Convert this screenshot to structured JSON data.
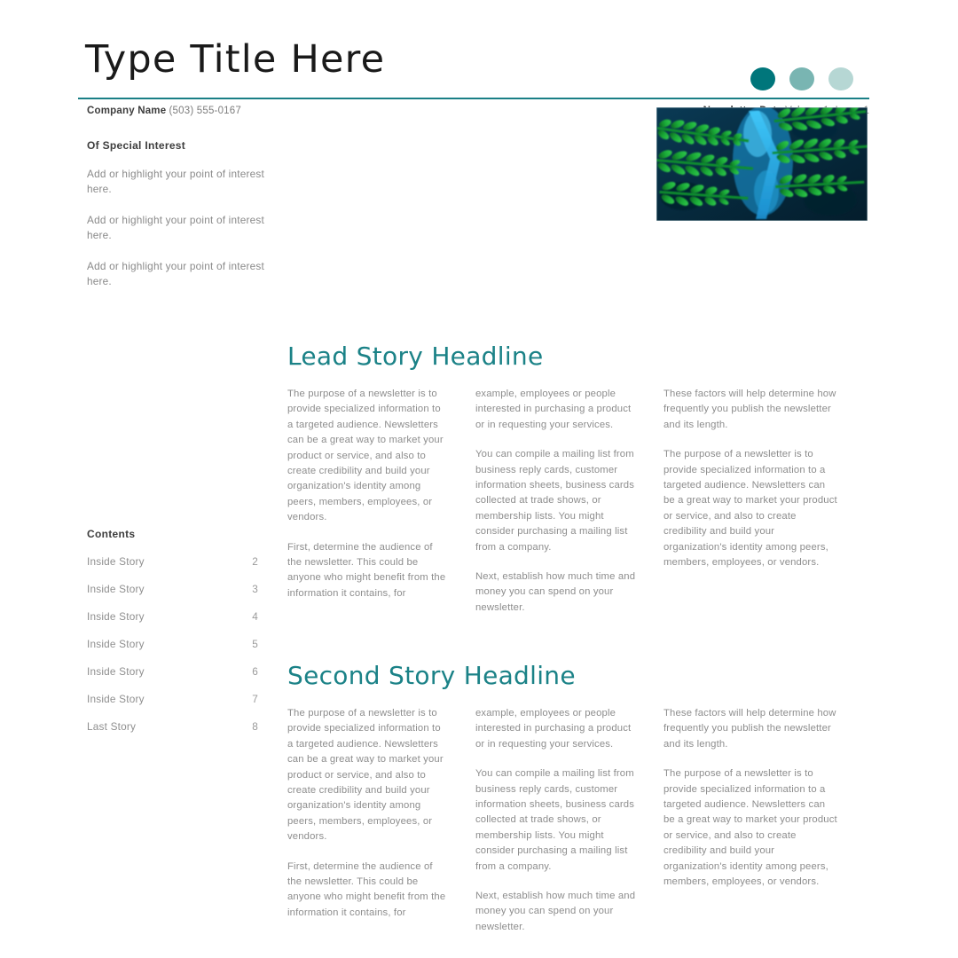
{
  "masthead": {
    "title": "Type Title Here",
    "dots": [
      {
        "name": "dot-dark",
        "color": "#00767b"
      },
      {
        "name": "dot-medium",
        "color": "#79b5b2"
      },
      {
        "name": "dot-light",
        "color": "#b6d7d4"
      }
    ],
    "rule_color": "#1a7f86"
  },
  "info": {
    "company_label": "Company Name",
    "company_phone": "(503) 555-0167",
    "date_label": "Newsletter Date",
    "volume_issue": "Volume 1, Issue 1"
  },
  "sidebar": {
    "special_interest": {
      "heading": "Of Special Interest",
      "items": [
        "Add or highlight your point of interest here.",
        "Add or highlight your point of interest here.",
        "Add or highlight your point of interest here."
      ]
    },
    "contents": {
      "heading": "Contents",
      "rows": [
        {
          "label": "Inside Story",
          "page": "2"
        },
        {
          "label": "Inside Story",
          "page": "3"
        },
        {
          "label": "Inside Story",
          "page": "4"
        },
        {
          "label": "Inside Story",
          "page": "5"
        },
        {
          "label": "Inside Story",
          "page": "6"
        },
        {
          "label": "Inside Story",
          "page": "7"
        },
        {
          "label": "Last Story",
          "page": "8"
        }
      ]
    }
  },
  "photo": {
    "alt": "fern-photograph",
    "colors": {
      "background": "#062b3f",
      "frond_bright": "#19b03a",
      "frond_mid": "#0e8f2e",
      "frond_dark": "#06491c",
      "stem_blue": "#2bb9f0",
      "deep_blue": "#0a3d63"
    }
  },
  "stories": [
    {
      "headline": "Lead Story Headline",
      "columns": [
        [
          "The purpose of a newsletter is to provide specialized information to a targeted audience. Newsletters can be a great way to market your product or service, and also to create credibility and build your organization's identity among peers, members, employees, or vendors.",
          "First, determine the audience of the newsletter. This could be anyone who might benefit from the information it contains, for"
        ],
        [
          "example, employees or people interested in purchasing a product or in requesting your services.",
          "You can compile a mailing list from business reply cards, customer information sheets, business cards collected at trade shows, or membership lists. You might consider purchasing a mailing list from a company.",
          "Next, establish how much time and money you can spend on your newsletter."
        ],
        [
          "These factors will help determine how frequently you publish the newsletter and its length.",
          "The purpose of a newsletter is to provide specialized information to a targeted audience. Newsletters can be a great way to market your product or service, and also to create credibility and build your organization's identity among peers, members, employees, or vendors."
        ]
      ]
    },
    {
      "headline": "Second Story Headline",
      "columns": [
        [
          "The purpose of a newsletter is to provide specialized information to a targeted audience. Newsletters can be a great way to market your product or service, and also to create credibility and build your organization's identity among peers, members, employees, or vendors.",
          "First, determine the audience of the newsletter. This could be anyone who might benefit from the information it contains, for"
        ],
        [
          "example, employees or people interested in purchasing a product or in requesting your services.",
          "You can compile a mailing list from business reply cards, customer information sheets, business cards collected at trade shows, or membership lists. You might consider purchasing a mailing list from a company.",
          "Next, establish how much time and money you can spend on your newsletter."
        ],
        [
          "These factors will help determine how frequently you publish the newsletter and its length.",
          "The purpose of a newsletter is to provide specialized information to a targeted audience. Newsletters can be a great way to market your product or service, and also to create credibility and build your organization's identity among peers, members, employees, or vendors."
        ]
      ]
    }
  ]
}
